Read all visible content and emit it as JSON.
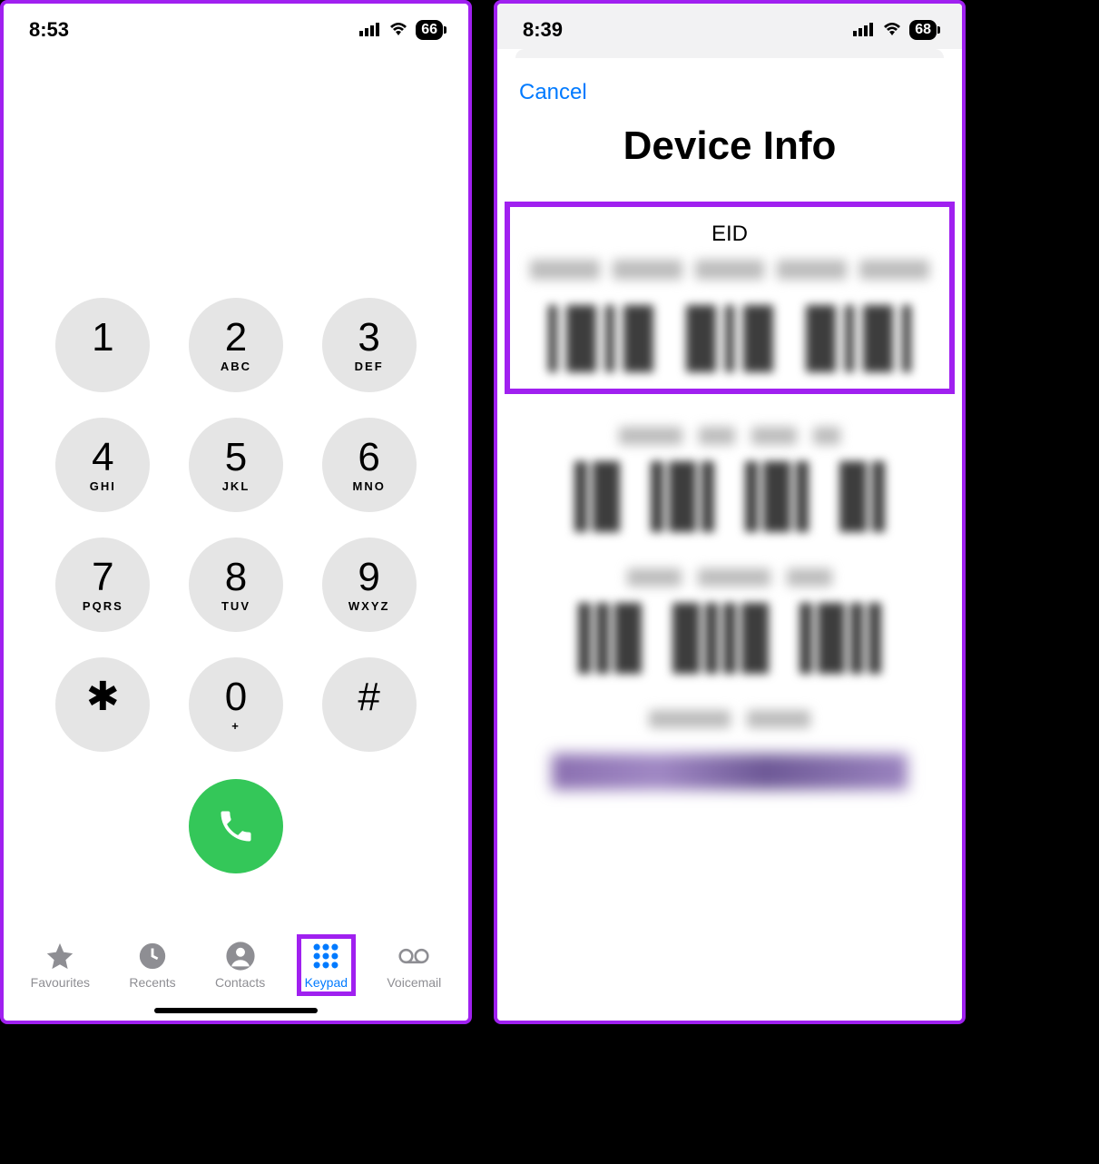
{
  "left": {
    "status": {
      "time": "8:53",
      "battery": "66"
    },
    "keys": [
      {
        "digit": "1",
        "letters": ""
      },
      {
        "digit": "2",
        "letters": "ABC"
      },
      {
        "digit": "3",
        "letters": "DEF"
      },
      {
        "digit": "4",
        "letters": "GHI"
      },
      {
        "digit": "5",
        "letters": "JKL"
      },
      {
        "digit": "6",
        "letters": "MNO"
      },
      {
        "digit": "7",
        "letters": "PQRS"
      },
      {
        "digit": "8",
        "letters": "TUV"
      },
      {
        "digit": "9",
        "letters": "WXYZ"
      },
      {
        "digit": "✱",
        "letters": ""
      },
      {
        "digit": "0",
        "letters": "+"
      },
      {
        "digit": "#",
        "letters": ""
      }
    ],
    "tabs": {
      "favourites": "Favourites",
      "recents": "Recents",
      "contacts": "Contacts",
      "keypad": "Keypad",
      "voicemail": "Voicemail"
    }
  },
  "right": {
    "status": {
      "time": "8:39",
      "battery": "68"
    },
    "cancel": "Cancel",
    "title": "Device Info",
    "eid_label": "EID"
  }
}
